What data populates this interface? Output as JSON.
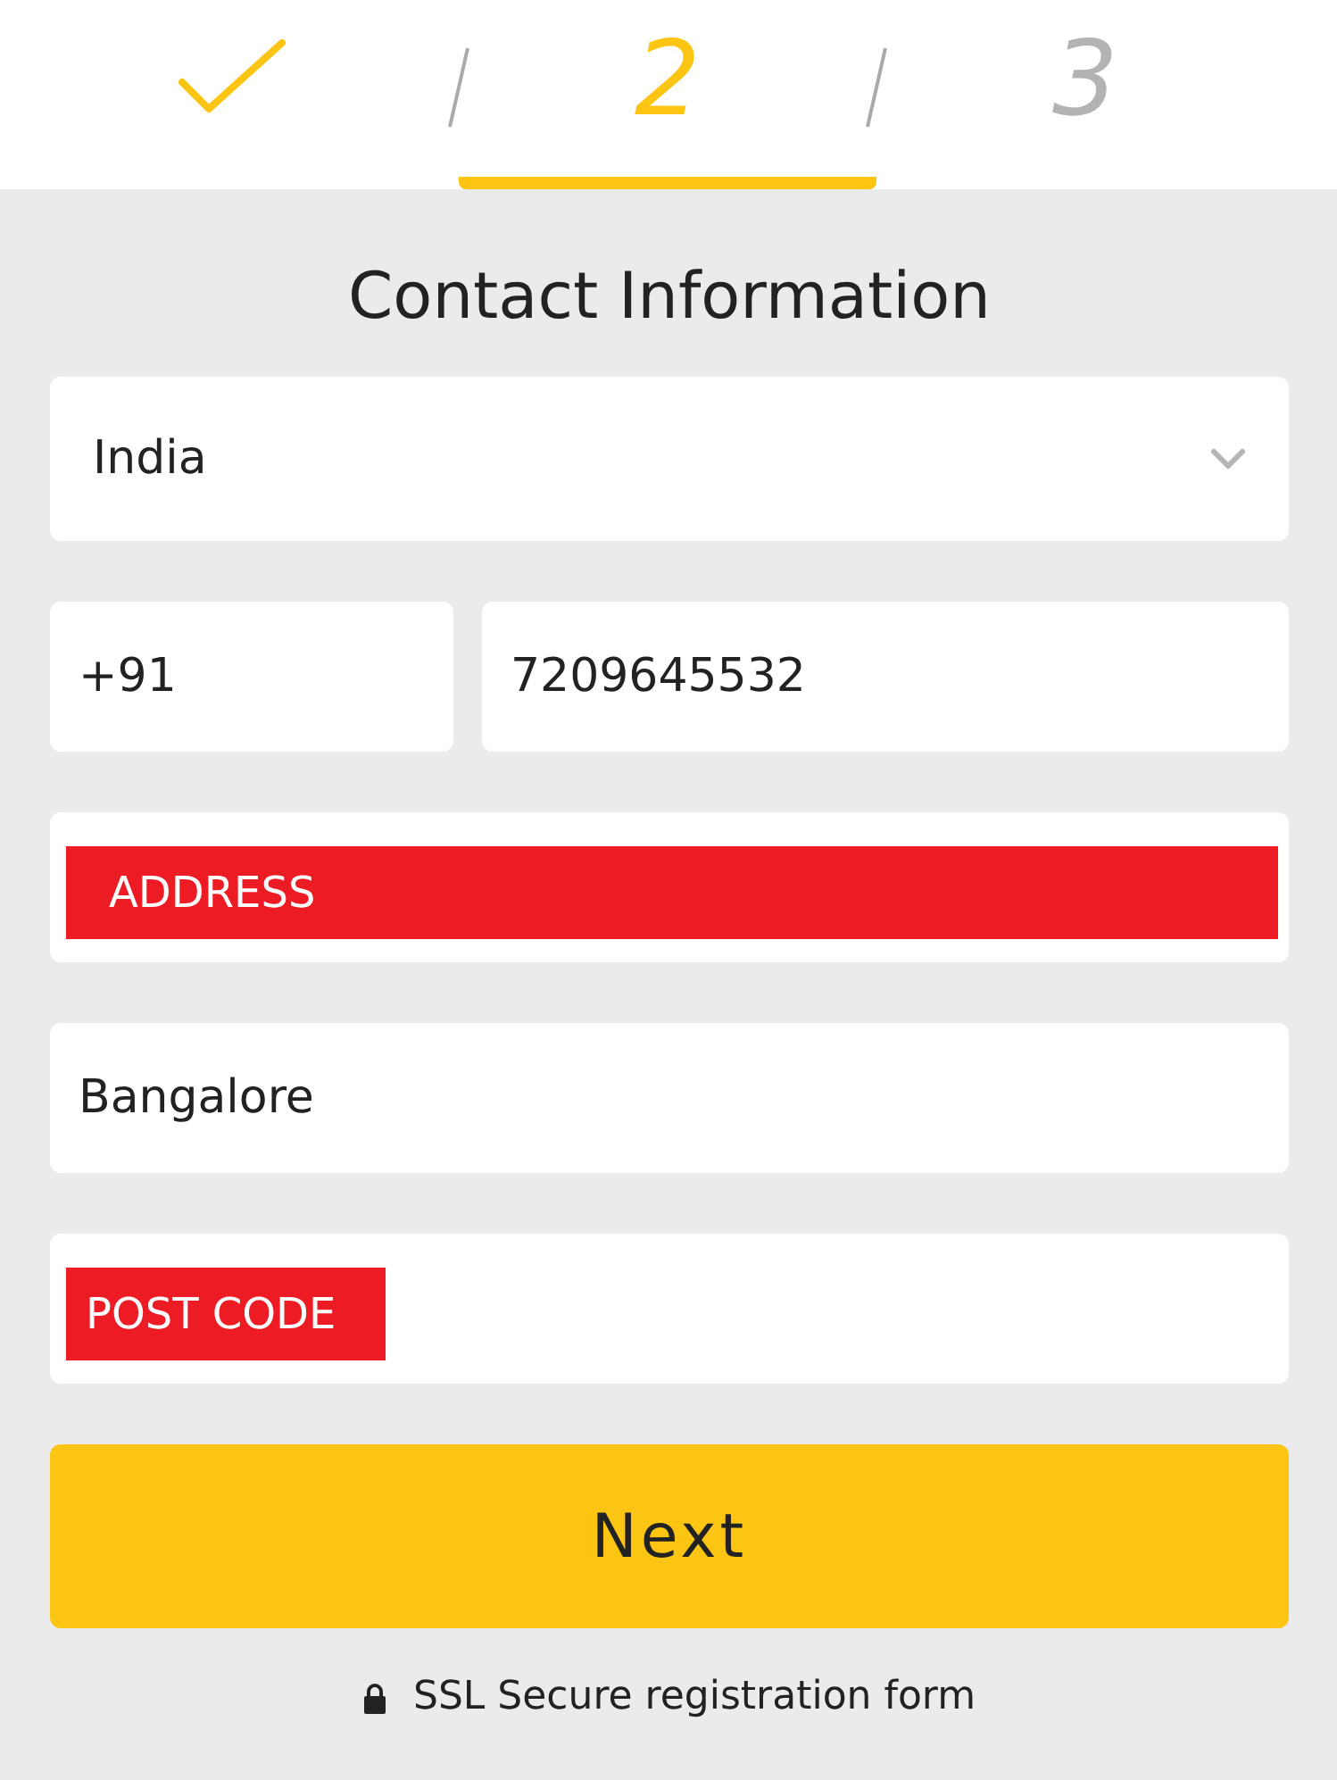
{
  "steps": [
    {
      "kind": "done",
      "selected": false
    },
    {
      "kind": "number",
      "label": "2",
      "selected": true
    },
    {
      "kind": "number",
      "label": "3",
      "selected": false
    }
  ],
  "title": "Contact Information",
  "country": {
    "value": "India"
  },
  "phone": {
    "code": "+91",
    "number": "7209645532"
  },
  "address": {
    "placeholder": "ADDRESS",
    "highlighted": true
  },
  "city": {
    "value": "Bangalore"
  },
  "post_code": {
    "placeholder": "POST CODE",
    "highlighted": true
  },
  "next_button": "Next",
  "footer": "SSL Secure registration form"
}
